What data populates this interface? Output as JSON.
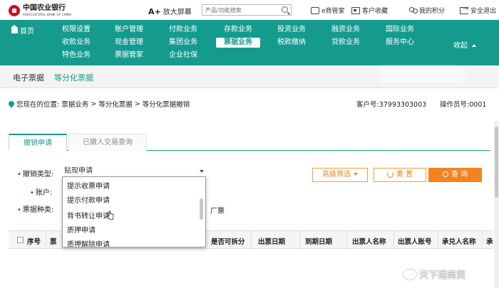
{
  "header": {
    "logo_cn": "中国农业银行",
    "logo_en": "AGRICULTURAL BANK OF CHINA",
    "font_size_prefix": "A+",
    "font_size_label": "放大屏幕",
    "search_placeholder": "产品/功能搜索",
    "links": [
      "e商管家",
      "客户收藏",
      "我的积分",
      "安全退出"
    ]
  },
  "nav": {
    "home": "首页",
    "items": [
      [
        "权限设置",
        "账户管理",
        "付款业务",
        "存款业务",
        "投资业务",
        "融资业务",
        "国际业务"
      ],
      [
        "收款业务",
        "现金管理",
        "集团业务",
        "票据业务",
        "税款缴纳",
        "贷款业务",
        "服务中心"
      ],
      [
        "特色业务",
        "票据管家",
        "企业社保"
      ]
    ],
    "collapse": "收起",
    "active": "票据业务"
  },
  "subtabs": {
    "items": [
      "电子票据",
      "等分化票据"
    ],
    "active": "等分化票据"
  },
  "breadcrumb": {
    "prefix": "您现在的位置:",
    "parts": [
      "票据业务",
      ">",
      "等分化票据",
      ">",
      "等分化票据撤销"
    ],
    "customer_label": "客户号:",
    "customer_no": "37993303003",
    "operator_label": "操作员号:",
    "operator_no": "0001"
  },
  "panel_tabs": {
    "tabs": [
      "撤销申请",
      "已撤人交易查询"
    ],
    "active": "撤销申请"
  },
  "form": {
    "labels": [
      "撤销类型:",
      "账户:",
      "票据种类:"
    ],
    "select_value": "贴现申请",
    "dropdown_options": [
      "提示收票申请",
      "提示付款申请",
      "背书转让申请",
      "质押申请",
      "质押解除申请"
    ],
    "partial_text": "厂票",
    "btn_combo": "高级筛选",
    "btn_reset": "重 置",
    "btn_query": "查 询"
  },
  "table": {
    "headers": [
      "序号",
      "票",
      "是否可拆分",
      "出票日期",
      "到期日期",
      "出票人名称",
      "出票人账号",
      "承兑人名称",
      "承"
    ]
  },
  "watermark": "天下通商贸",
  "colors": {
    "brand_green": "#159b8e",
    "orange": "#f58220",
    "bank_red": "#c8102e"
  }
}
